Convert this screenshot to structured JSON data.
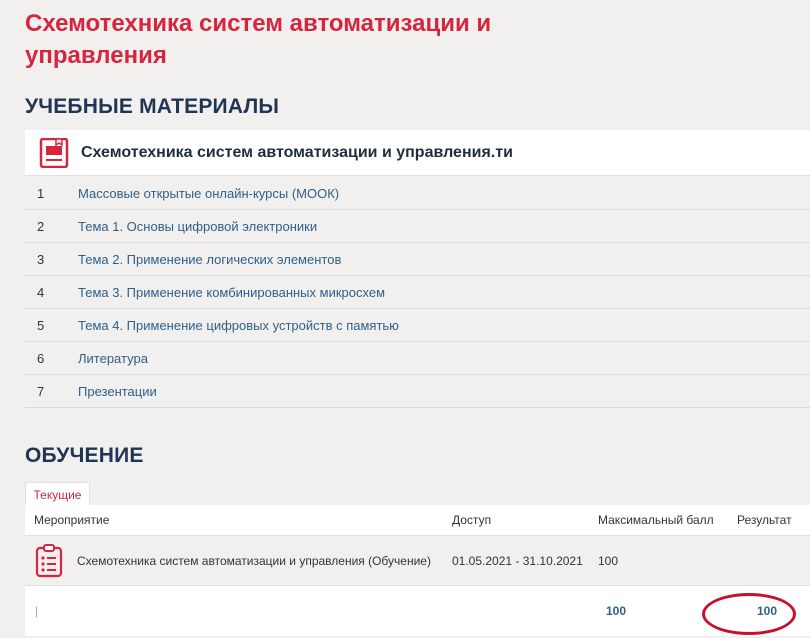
{
  "page": {
    "title": "Схемотехника систем автоматизации и управления"
  },
  "materials": {
    "heading": "УЧЕБНЫЕ МАТЕРИАЛЫ",
    "course_name": "Схемотехника систем автоматизации и управления.ти",
    "items": [
      {
        "num": "1",
        "label": "Массовые открытые онлайн-курсы (МООК)"
      },
      {
        "num": "2",
        "label": "Тема 1. Основы цифровой электроники"
      },
      {
        "num": "3",
        "label": "Тема 2. Применение логических элементов"
      },
      {
        "num": "4",
        "label": "Тема 3. Применение комбинированных микросхем"
      },
      {
        "num": "5",
        "label": "Тема 4. Применение цифровых устройств с памятью"
      },
      {
        "num": "6",
        "label": "Литература"
      },
      {
        "num": "7",
        "label": "Презентации"
      }
    ]
  },
  "learning": {
    "heading": "ОБУЧЕНИЕ",
    "tab_current": "Текущие",
    "columns": {
      "event": "Мероприятие",
      "access": "Доступ",
      "max": "Максимальный балл",
      "result": "Результат"
    },
    "row": {
      "event": "Схемотехника систем автоматизации и управления (Обучение)",
      "access": "01.05.2021 - 31.10.2021",
      "max": "100"
    },
    "total": {
      "marker": "|",
      "max": "100",
      "result": "100"
    }
  },
  "colors": {
    "accent": "#d6263f",
    "heading": "#1f3553",
    "link": "#2e5f8a",
    "highlight": "#c8102e"
  },
  "icons": {
    "course": "book-icon",
    "event": "checklist-icon"
  }
}
